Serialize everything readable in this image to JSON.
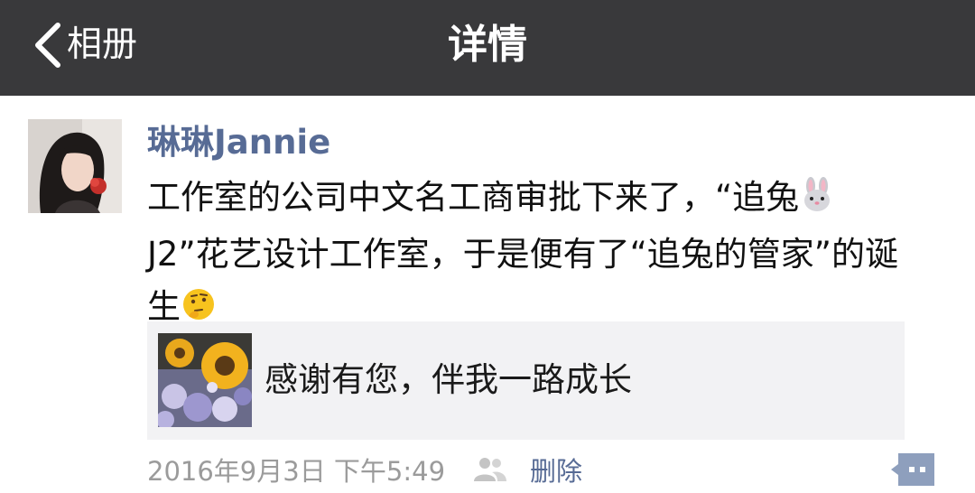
{
  "nav": {
    "back_label": "相册",
    "title": "详情",
    "background": "#39393b"
  },
  "post": {
    "author": "琳琳Jannie",
    "content_part1": "工作室的公司中文名工商审批下来了，“追兔",
    "content_part2": "J2”花艺设计工作室，于是便有了“追兔的管家”的诞生",
    "rabbit_emoji": "rabbit-face-icon",
    "thinking_emoji": "thinking-face-icon",
    "link": {
      "title": "感谢有您，伴我一路成长"
    },
    "timestamp": "2016年9月3日 下午5:49",
    "delete_label": "删除"
  },
  "colors": {
    "link_blue": "#576b95",
    "meta_gray": "#9b9b9b",
    "card_bg": "#f2f2f4"
  }
}
